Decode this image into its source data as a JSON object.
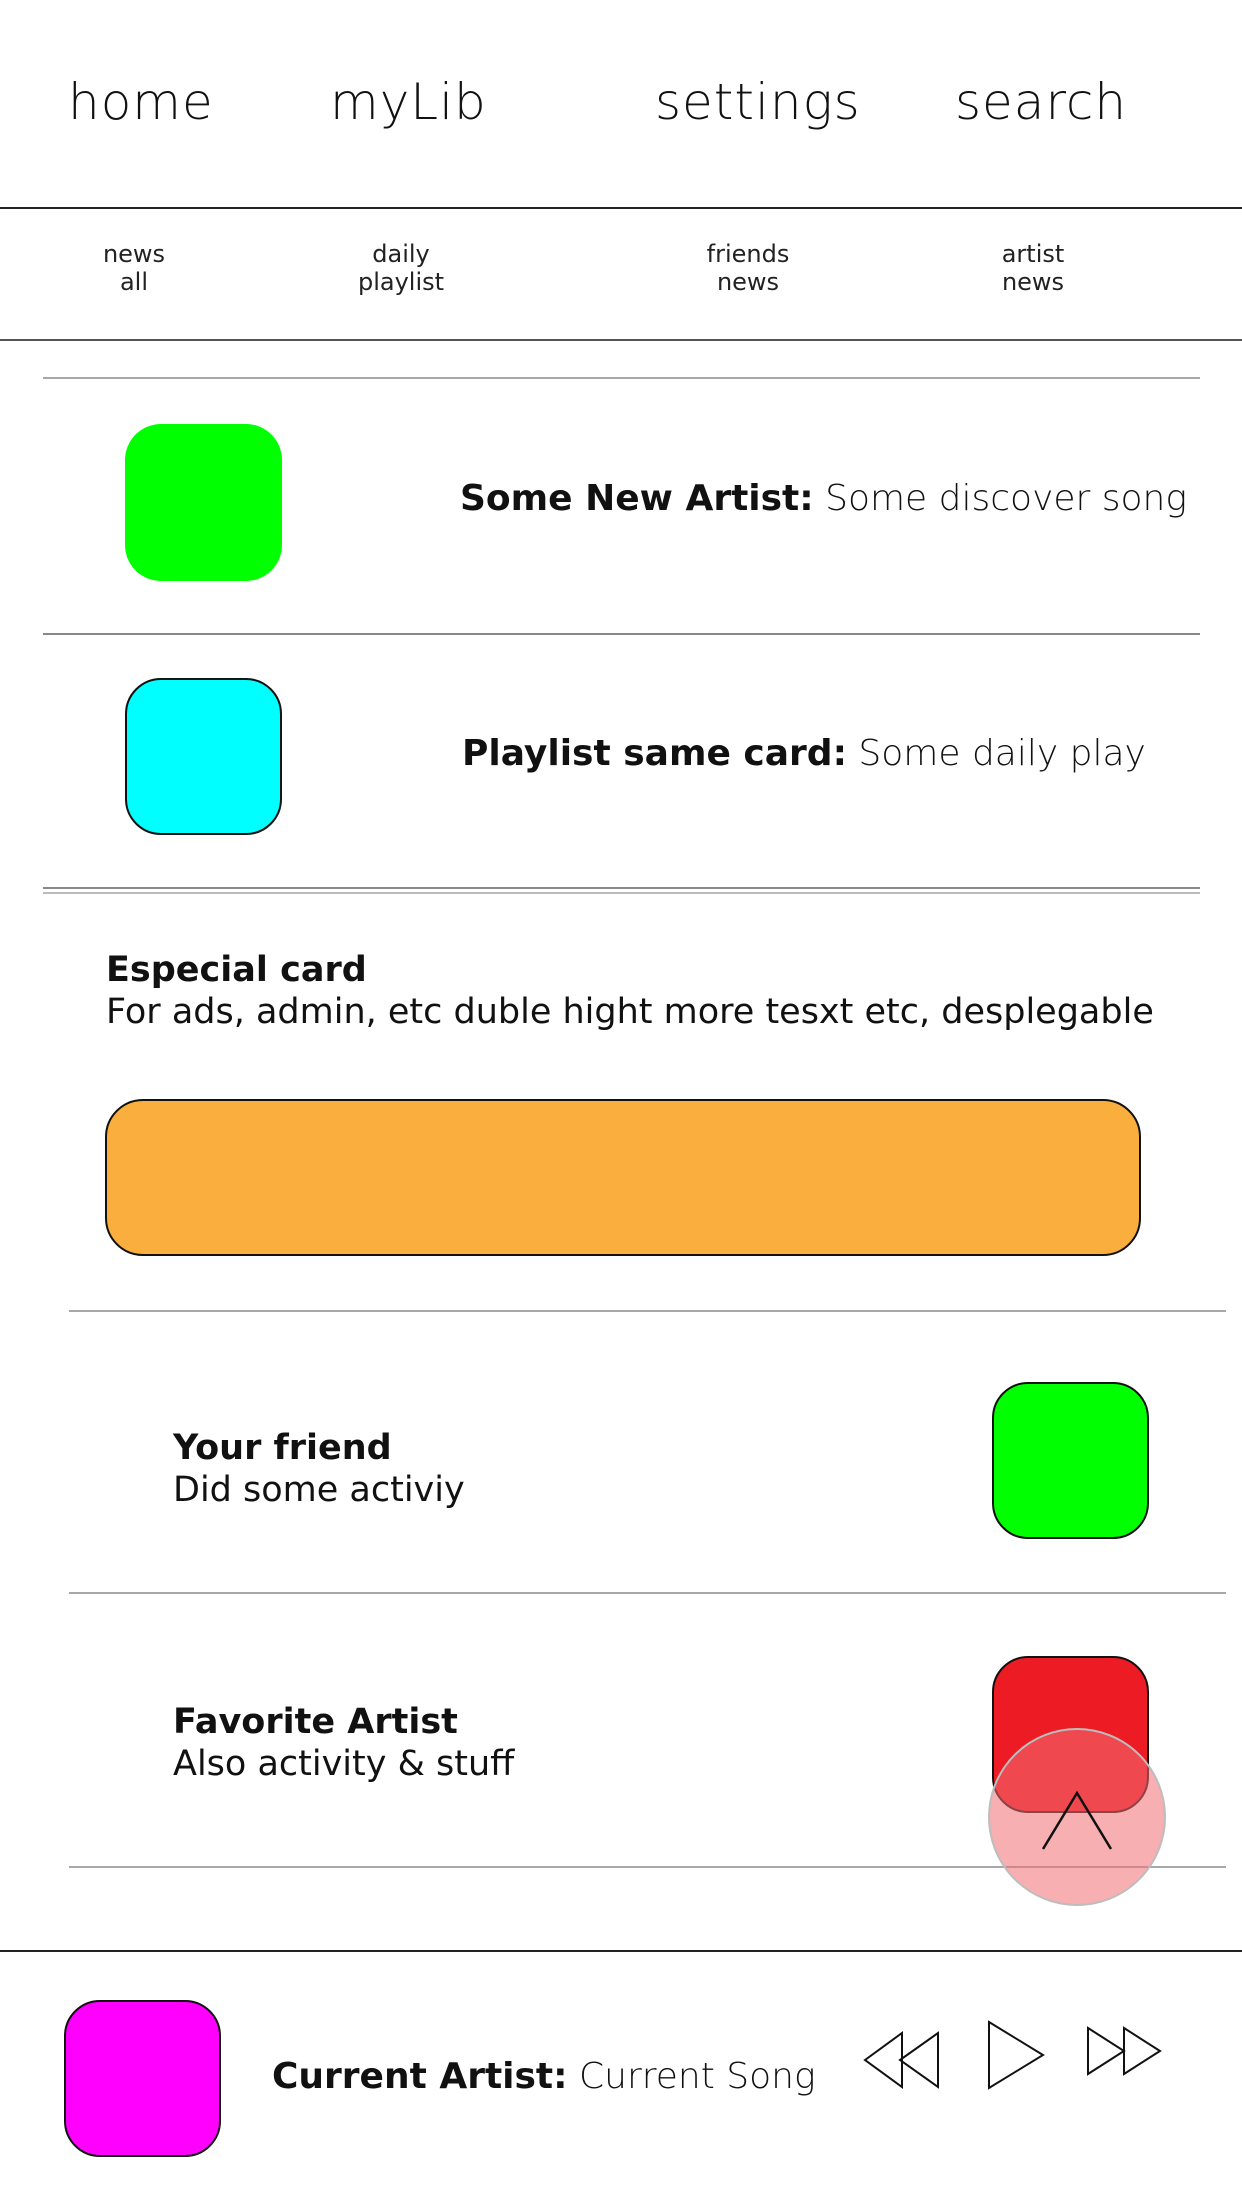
{
  "nav": {
    "home": "home",
    "mylib": "myLib",
    "settings": "settings",
    "search": "search"
  },
  "subtabs": [
    {
      "line1": "news",
      "line2": "all"
    },
    {
      "line1": "daily",
      "line2": "playlist"
    },
    {
      "line1": "friends",
      "line2": "news"
    },
    {
      "line1": "artist",
      "line2": "news"
    }
  ],
  "feed": {
    "new_artist": {
      "title": "Some New Artist:",
      "subtitle": "Some discover song",
      "color": "#00ff00"
    },
    "playlist": {
      "title": "Playlist same card:",
      "subtitle": "Some daily play",
      "color": "#00ffff"
    },
    "special": {
      "title": "Especial card",
      "subtitle": "For ads, admin, etc duble hight more tesxt etc, desplegable",
      "color": "#f9ae3d"
    },
    "friend": {
      "title": "Your friend",
      "subtitle": "Did some activiy",
      "color": "#00ff00"
    },
    "favorite": {
      "title": "Favorite Artist",
      "subtitle": "Also activity & stuff",
      "color": "#ed1c24"
    }
  },
  "player": {
    "artist": "Current Artist:",
    "song": "Current Song",
    "art_color": "#ff00ff"
  },
  "icons": {
    "scroll_top": "chevron-up-icon",
    "rewind": "rewind-icon",
    "play": "play-icon",
    "forward": "fast-forward-icon"
  }
}
